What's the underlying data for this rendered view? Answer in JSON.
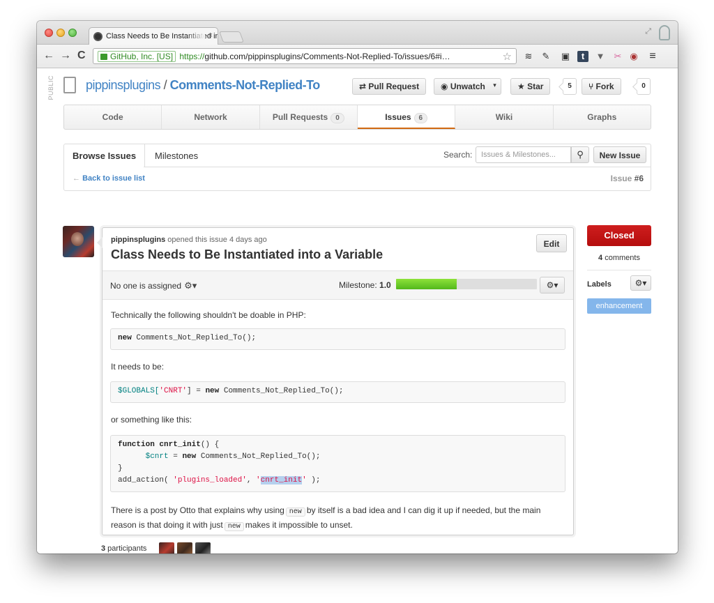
{
  "browser": {
    "tab_title": "Class Needs to Be Instantiated into a Variable",
    "tab_close": "×",
    "ev_label": "GitHub, Inc. [US]",
    "url_scheme": "https://",
    "url_rest": "github.com/pippinsplugins/Comments-Not-Replied-To/issues/6#i…",
    "back": "←",
    "forward": "→",
    "reload": "C",
    "bookmark_star": "☆",
    "extensions": [
      "≋",
      "✎",
      "▣",
      "t",
      "▼",
      "✂",
      "◉",
      "≡"
    ]
  },
  "repo": {
    "public_tag": "PUBLIC",
    "owner": "pippinsplugins",
    "separator": " / ",
    "name": "Comments-Not-Replied-To",
    "pull_request_label": "Pull Request",
    "unwatch_label": "Unwatch",
    "star_label": "Star",
    "star_count": "5",
    "fork_label": "Fork",
    "fork_count": "0"
  },
  "nav": {
    "tabs": [
      {
        "label": "Code",
        "count": null,
        "selected": false
      },
      {
        "label": "Network",
        "count": null,
        "selected": false
      },
      {
        "label": "Pull Requests",
        "count": "0",
        "selected": false
      },
      {
        "label": "Issues",
        "count": "6",
        "selected": true
      },
      {
        "label": "Wiki",
        "count": null,
        "selected": false
      },
      {
        "label": "Graphs",
        "count": null,
        "selected": false
      }
    ]
  },
  "issues_nav": {
    "browse": "Browse Issues",
    "milestones": "Milestones",
    "search_label": "Search:",
    "search_placeholder": "Issues & Milestones...",
    "new_issue": "New Issue",
    "back_link": "Back to issue list",
    "issue_prefix": "Issue ",
    "issue_number": "#6"
  },
  "issue": {
    "author": "pippinsplugins",
    "opened_text": " opened this issue 4 days ago",
    "title": "Class Needs to Be Instantiated into a Variable",
    "edit_label": "Edit",
    "assignee_text": "No one is assigned",
    "milestone_label": "Milestone: ",
    "milestone_value": "1.0",
    "milestone_progress": 0.43,
    "para1": "Technically the following shouldn't be doable in PHP:",
    "para2": "It needs to be:",
    "para3": "or something like this:",
    "para4_a": "There is a post by Otto that explains why using",
    "para4_code1": "new",
    "para4_b": "by itself is a bad idea and I can dig it up if needed, but the main",
    "para4_c": "reason is that doing it with just",
    "para4_code2": "new",
    "para4_d": "makes it impossible to unset."
  },
  "code1": {
    "kw": "new",
    "rest": " Comments_Not_Replied_To();"
  },
  "code2": {
    "var": "$GLOBALS[",
    "str": "'CNRT'",
    "mid": "] = ",
    "kw": "new",
    "rest": " Comments_Not_Replied_To();"
  },
  "code3": {
    "l1_kw": "function",
    "l1_name": " cnrt_init",
    "l1_rest": "() {",
    "l2_indent": "      ",
    "l2_var": "$cnrt",
    "l2_mid": " = ",
    "l2_kw": "new",
    "l2_rest": " Comments_Not_Replied_To();",
    "l3": "}",
    "l4_a": "add_action( ",
    "l4_s1": "'plugins_loaded'",
    "l4_b": ", ",
    "l4_q1": "'",
    "l4_sel": "cnrt_init",
    "l4_q2": "'",
    "l4_c": " );"
  },
  "sidebar": {
    "status": "Closed",
    "comments_count": "4",
    "comments_label": " comments",
    "labels_title": "Labels",
    "label": "enhancement"
  },
  "participants": {
    "count": "3",
    "label": " participants"
  },
  "colors": {
    "closed": "#bd1010",
    "label": "#84b6eb",
    "link": "#4183c4",
    "progress": "#6cc644"
  }
}
